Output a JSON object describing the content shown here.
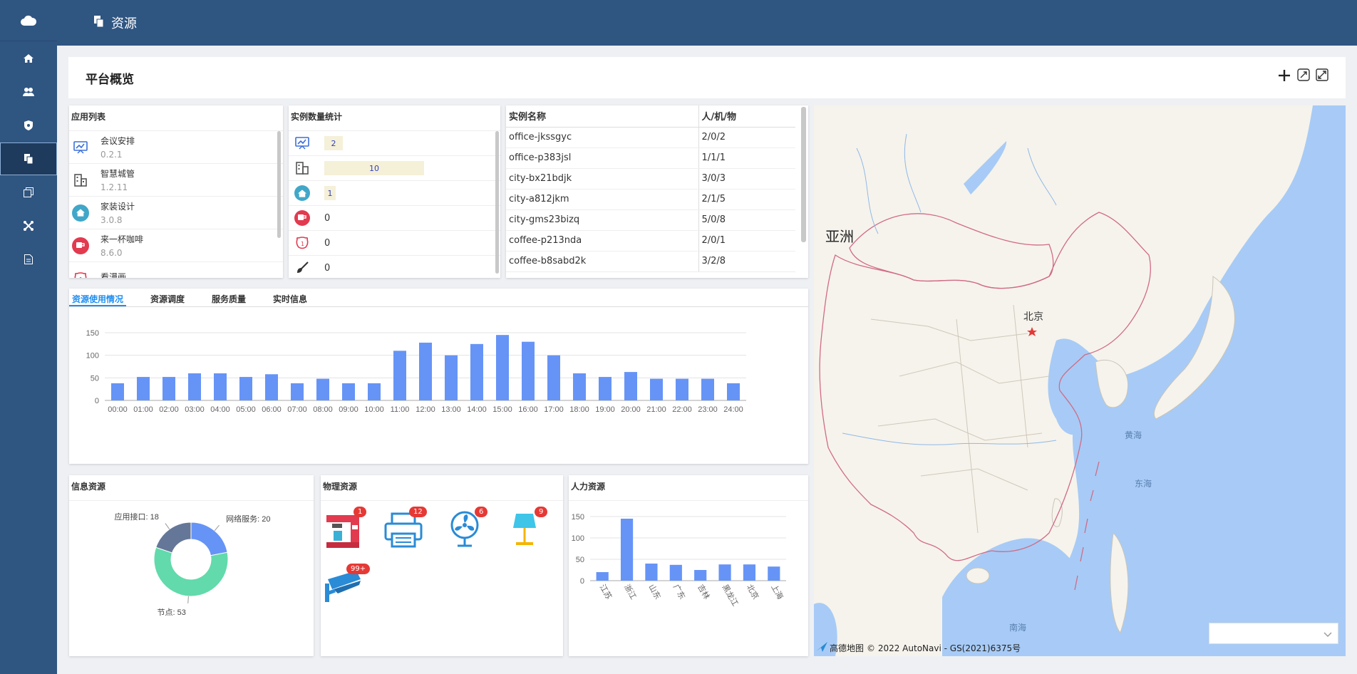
{
  "app": {
    "section_title": "资源"
  },
  "overview": {
    "title": "平台概览"
  },
  "app_list": {
    "title": "应用列表",
    "items": [
      {
        "name": "会议安排",
        "version": "0.2.1"
      },
      {
        "name": "智慧城管",
        "version": "1.2.11"
      },
      {
        "name": "家装设计",
        "version": "3.0.8"
      },
      {
        "name": "来一杯咖啡",
        "version": "8.6.0"
      },
      {
        "name": "看漫画",
        "version": ""
      }
    ]
  },
  "instance_stats": {
    "title": "实例数量统计",
    "values": [
      "2",
      "10",
      "1",
      "0",
      "0",
      "0"
    ]
  },
  "instances": {
    "headers": [
      "实例名称",
      "人/机/物"
    ],
    "rows": [
      [
        "office-jkssgyc",
        "2/0/2"
      ],
      [
        "office-p383jsl",
        "1/1/1"
      ],
      [
        "city-bx21bdjk",
        "3/0/3"
      ],
      [
        "city-a812jkm",
        "2/1/5"
      ],
      [
        "city-gms23bizq",
        "5/0/8"
      ],
      [
        "coffee-p213nda",
        "2/0/1"
      ],
      [
        "coffee-b8sabd2k",
        "3/2/8"
      ]
    ]
  },
  "tabs": [
    "资源使用情况",
    "资源调度",
    "服务质量",
    "实时信息"
  ],
  "info_resources": {
    "title": "信息资源"
  },
  "physical_resources": {
    "title": "物理资源",
    "badges": [
      "1",
      "12",
      "6",
      "9",
      "99+"
    ]
  },
  "human_resources": {
    "title": "人力资源"
  },
  "map": {
    "label_asia": "亚洲",
    "label_beijing": "北京",
    "label_yellow_sea": "黄海",
    "label_east_sea": "东海",
    "label_south_sea": "南海",
    "attribution_logo": "高德地图",
    "attribution": "© 2022 AutoNavi - GS(2021)6375号"
  },
  "chart_data": [
    {
      "type": "bar",
      "categories": [
        "00:00",
        "01:00",
        "02:00",
        "03:00",
        "04:00",
        "05:00",
        "06:00",
        "07:00",
        "08:00",
        "09:00",
        "10:00",
        "11:00",
        "12:00",
        "13:00",
        "14:00",
        "15:00",
        "16:00",
        "17:00",
        "18:00",
        "19:00",
        "20:00",
        "21:00",
        "22:00",
        "23:00",
        "24:00"
      ],
      "values": [
        38,
        52,
        52,
        60,
        60,
        52,
        58,
        38,
        48,
        38,
        38,
        110,
        128,
        100,
        125,
        145,
        130,
        100,
        60,
        52,
        63,
        48,
        48,
        48,
        38
      ],
      "ylim": [
        0,
        150
      ],
      "yticks": [
        0,
        50,
        100,
        150
      ],
      "color": "#6694f6"
    },
    {
      "type": "pie",
      "labels": [
        "网络服务",
        "节点",
        "应用接口"
      ],
      "values": [
        20,
        53,
        18
      ],
      "label_texts": [
        "网络服务: 20",
        "节点: 53",
        "应用接口: 18"
      ],
      "colors": [
        "#6694f6",
        "#62daab",
        "#657798"
      ]
    },
    {
      "type": "bar",
      "categories": [
        "江苏",
        "浙江",
        "山东",
        "广东",
        "吉林",
        "黑龙江",
        "北京",
        "上海"
      ],
      "values": [
        20,
        145,
        40,
        37,
        25,
        38,
        38,
        33
      ],
      "ylim": [
        0,
        150
      ],
      "yticks": [
        0,
        50,
        100,
        150
      ],
      "color": "#6694f6"
    }
  ]
}
